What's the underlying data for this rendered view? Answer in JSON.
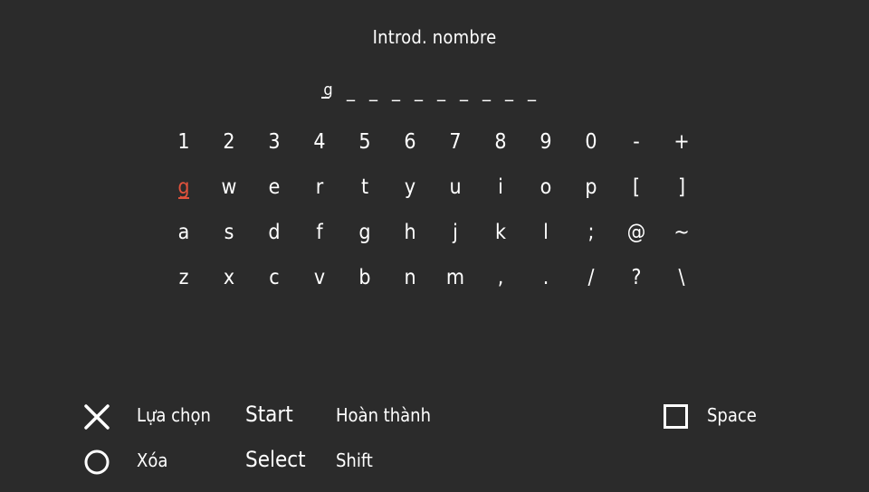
{
  "header": {
    "title": "Introd. nombre"
  },
  "entry": {
    "typed": "g",
    "blank_slots": 9
  },
  "keyboard": {
    "selected": "g",
    "rows": [
      [
        "1",
        "2",
        "3",
        "4",
        "5",
        "6",
        "7",
        "8",
        "9",
        "0",
        "-",
        "+"
      ],
      [
        "g",
        "w",
        "e",
        "r",
        "t",
        "y",
        "u",
        "i",
        "o",
        "p",
        "[",
        "]"
      ],
      [
        "a",
        "s",
        "d",
        "f",
        "g",
        "h",
        "j",
        "k",
        "l",
        ";",
        "@",
        "~"
      ],
      [
        "z",
        "x",
        "c",
        "v",
        "b",
        "n",
        "m",
        ",",
        ".",
        "/",
        "?",
        "\\"
      ]
    ]
  },
  "legend": {
    "cross_label": "Lựa chọn",
    "circle_label": "Xóa",
    "start_button": "Start",
    "start_label": "Hoàn thành",
    "select_button": "Select",
    "select_label": "Shift",
    "square_label": "Space"
  },
  "icons": {
    "cross": "cross-button-icon",
    "circle": "circle-button-icon",
    "square": "square-button-icon"
  },
  "colors": {
    "background": "#2b2b2b",
    "text": "#ffffff",
    "highlight": "#e0523c"
  }
}
